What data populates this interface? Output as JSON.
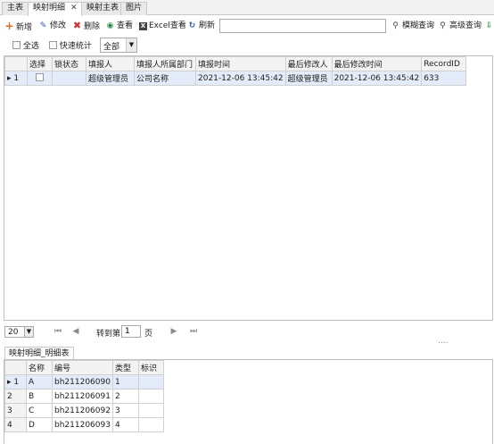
{
  "tabs": [
    {
      "label": "主表",
      "active": false
    },
    {
      "label": "映射明细",
      "active": true,
      "closable": true
    },
    {
      "label": "映射主表",
      "active": false
    },
    {
      "label": "图片",
      "active": false
    }
  ],
  "toolbar": {
    "new": "新增",
    "edit": "修改",
    "delete": "删除",
    "view": "查看",
    "excel_view": "Excel查看",
    "refresh": "刷新",
    "search_value": "",
    "fuzzy_query": "模糊查询",
    "advanced_query": "高级查询"
  },
  "filter": {
    "select_all": "全选",
    "quick_stats": "快速统计",
    "scope": "全部"
  },
  "grid": {
    "columns": [
      "选择",
      "锁状态",
      "填报人",
      "填报人所属部门",
      "填报时间",
      "最后修改人",
      "最后修改时间",
      "RecordID"
    ],
    "rows": [
      {
        "indicator": "▸ 1",
        "selected": false,
        "lock": "",
        "filler": "超级管理员",
        "dept": "公司名称",
        "fill_time": "2021-12-06 13:45:42",
        "modifier": "超级管理员",
        "modify_time": "2021-12-06 13:45:42",
        "record_id": "633"
      }
    ]
  },
  "pager": {
    "page_size": "20",
    "goto_label": "转到第",
    "page": "1",
    "page_suffix": "页",
    "dots": "...."
  },
  "detail": {
    "tab_label": "映射明细_明细表",
    "columns": [
      "名称",
      "编号",
      "类型",
      "标识"
    ],
    "rows": [
      {
        "indicator": "▸ 1",
        "name": "A",
        "code": "bh211206090",
        "type": "1",
        "mark": ""
      },
      {
        "indicator": "2",
        "name": "B",
        "code": "bh211206091",
        "type": "2",
        "mark": ""
      },
      {
        "indicator": "3",
        "name": "C",
        "code": "bh211206092",
        "type": "3",
        "mark": ""
      },
      {
        "indicator": "4",
        "name": "D",
        "code": "bh211206093",
        "type": "4",
        "mark": ""
      }
    ]
  }
}
